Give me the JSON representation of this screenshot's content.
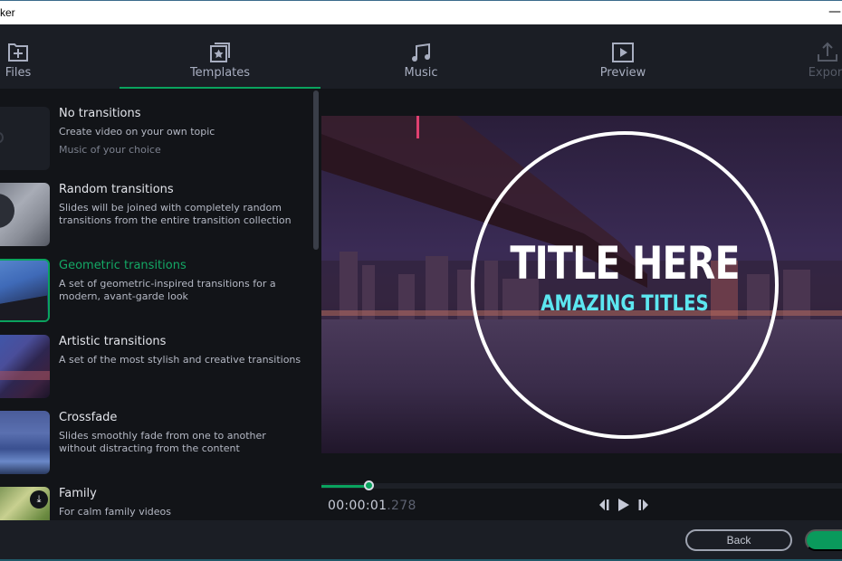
{
  "window": {
    "title": "ker",
    "minimize_glyph": "—"
  },
  "toolbar": {
    "tabs": [
      {
        "label": "Files",
        "icon": "folder-add-icon",
        "state": "normal"
      },
      {
        "label": "Templates",
        "icon": "templates-star-icon",
        "state": "active"
      },
      {
        "label": "Music",
        "icon": "music-note-icon",
        "state": "normal"
      },
      {
        "label": "Preview",
        "icon": "play-square-icon",
        "state": "normal"
      },
      {
        "label": "Export",
        "icon": "export-upload-icon",
        "state": "disabled"
      }
    ]
  },
  "templates": {
    "items": [
      {
        "title": "No transitions",
        "description": "Create video on your own topic",
        "subtitle": "Music of your choice",
        "selected": false
      },
      {
        "title": "Random transitions",
        "description": "Slides will be joined with completely random transitions from the entire transition collection",
        "selected": false
      },
      {
        "title": "Geometric transitions",
        "description": "A set of geometric-inspired transitions for a modern, avant-garde look",
        "selected": true
      },
      {
        "title": "Artistic transitions",
        "description": "A set of the most stylish and creative transitions",
        "selected": false
      },
      {
        "title": "Crossfade",
        "description": "Slides smoothly fade from one to another without distracting from the content",
        "selected": false
      },
      {
        "title": "Family",
        "description": "For calm family videos",
        "selected": false,
        "download": true
      }
    ]
  },
  "preview": {
    "title_text": "TITLE HERE",
    "subtitle_text": "AMAZING TITLES",
    "title_color": "#ffffff",
    "subtitle_color": "#5ce6f0",
    "progress_fraction": 0.09,
    "timecode_main": "00:00:01",
    "timecode_ms": ".278"
  },
  "footer": {
    "back_label": "Back",
    "next_label": ""
  },
  "colors": {
    "accent": "#0aa35e",
    "background": "#1b1e25",
    "panel": "#121418"
  }
}
